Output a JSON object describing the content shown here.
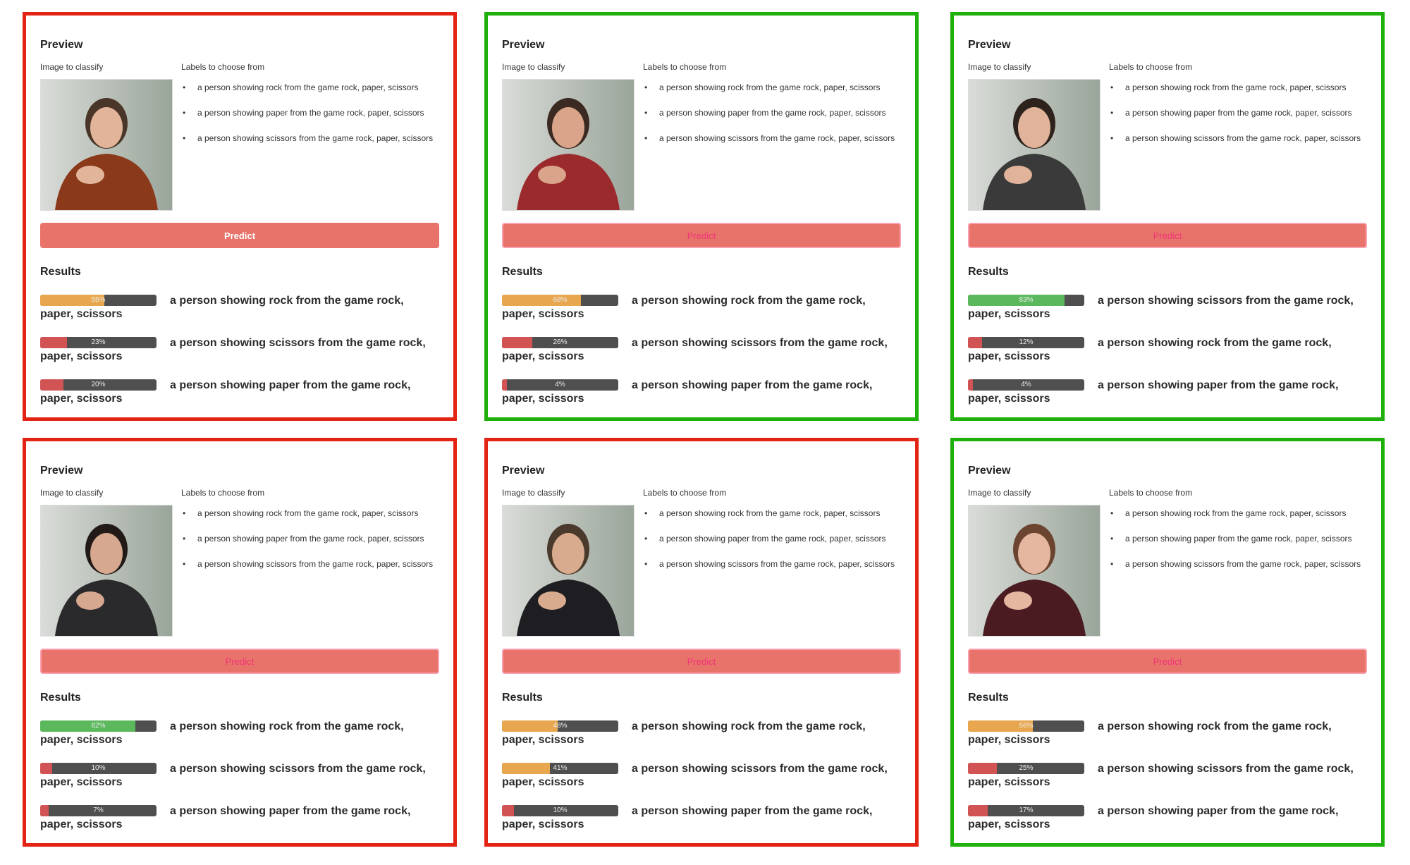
{
  "common": {
    "preview_heading": "Preview",
    "image_label": "Image to classify",
    "labels_heading": "Labels to choose from",
    "candidate_labels": [
      "a person showing rock from the game rock, paper, scissors",
      "a person showing paper from the game rock, paper, scissors",
      "a person showing scissors from the game rock, paper, scissors"
    ],
    "predict_label": "Predict",
    "results_heading": "Results"
  },
  "colors": {
    "incorrect_border": "#e32414",
    "correct_border": "#1fb00c",
    "predict_button": "#e7736a",
    "bar_high": "#5cb85c",
    "bar_mid": "#e8a64e",
    "bar_low": "#d15353",
    "bar_track": "#4f4f4f"
  },
  "panels": [
    {
      "outcome": "incorrect",
      "image": "woman in rust sweater showing flat hand (paper)",
      "button_state": "default",
      "results": [
        {
          "label": "a person showing rock from the game rock, paper, scissors",
          "percent": 55,
          "pct_text": "55%",
          "level": "orange"
        },
        {
          "label": "a person showing scissors from the game rock, paper, scissors",
          "percent": 23,
          "pct_text": "23%",
          "level": "red"
        },
        {
          "label": "a person showing paper from the game rock, paper, scissors",
          "percent": 20,
          "pct_text": "20%",
          "level": "red"
        }
      ]
    },
    {
      "outcome": "correct",
      "image": "man in red hoodie showing fist (rock)",
      "button_state": "loading",
      "results": [
        {
          "label": "a person showing rock from the game rock, paper, scissors",
          "percent": 68,
          "pct_text": "68%",
          "level": "orange"
        },
        {
          "label": "a person showing scissors from the game rock, paper, scissors",
          "percent": 26,
          "pct_text": "26%",
          "level": "red"
        },
        {
          "label": "a person showing paper from the game rock, paper, scissors",
          "percent": 4,
          "pct_text": "4%",
          "level": "red"
        }
      ]
    },
    {
      "outcome": "correct",
      "image": "woman in striped shirt showing two fingers (scissors)",
      "button_state": "loading",
      "results": [
        {
          "label": "a person showing scissors from the game rock, paper, scissors",
          "percent": 83,
          "pct_text": "83%",
          "level": "green"
        },
        {
          "label": "a person showing rock from the game rock, paper, scissors",
          "percent": 12,
          "pct_text": "12%",
          "level": "red"
        },
        {
          "label": "a person showing paper from the game rock, paper, scissors",
          "percent": 4,
          "pct_text": "4%",
          "level": "red"
        }
      ]
    },
    {
      "outcome": "incorrect",
      "image": "man in black jacket showing raised flat hand (paper)",
      "button_state": "loading",
      "results": [
        {
          "label": "a person showing rock from the game rock, paper, scissors",
          "percent": 82,
          "pct_text": "82%",
          "level": "green"
        },
        {
          "label": "a person showing scissors from the game rock, paper, scissors",
          "percent": 10,
          "pct_text": "10%",
          "level": "red"
        },
        {
          "label": "a person showing paper from the game rock, paper, scissors",
          "percent": 7,
          "pct_text": "7%",
          "level": "red"
        }
      ]
    },
    {
      "outcome": "incorrect",
      "image": "man with headphones showing two fingers (scissors)",
      "button_state": "loading",
      "results": [
        {
          "label": "a person showing rock from the game rock, paper, scissors",
          "percent": 48,
          "pct_text": "48%",
          "level": "orange"
        },
        {
          "label": "a person showing scissors from the game rock, paper, scissors",
          "percent": 41,
          "pct_text": "41%",
          "level": "orange"
        },
        {
          "label": "a person showing paper from the game rock, paper, scissors",
          "percent": 10,
          "pct_text": "10%",
          "level": "red"
        }
      ]
    },
    {
      "outcome": "correct",
      "image": "woman in maroon cardigan showing fist (rock)",
      "button_state": "loading",
      "results": [
        {
          "label": "a person showing rock from the game rock, paper, scissors",
          "percent": 56,
          "pct_text": "56%",
          "level": "orange"
        },
        {
          "label": "a person showing scissors from the game rock, paper, scissors",
          "percent": 25,
          "pct_text": "25%",
          "level": "red"
        },
        {
          "label": "a person showing paper from the game rock, paper, scissors",
          "percent": 17,
          "pct_text": "17%",
          "level": "red"
        }
      ]
    }
  ]
}
